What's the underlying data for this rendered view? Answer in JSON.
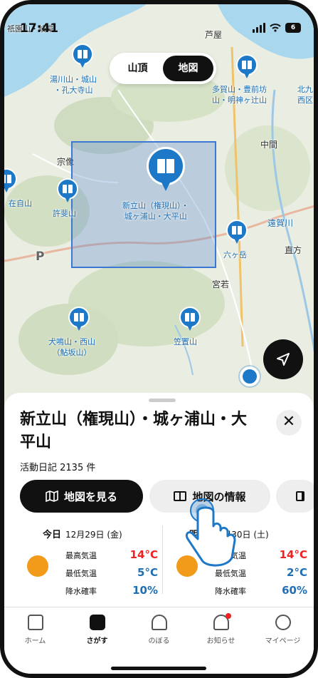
{
  "status": {
    "time": "17:41",
    "battery": "6"
  },
  "map_toggle": {
    "summit_label": "山頂",
    "map_label": "地図",
    "selected": "地図"
  },
  "map_labels": {
    "top_left_corner": "祇園山・岐阜",
    "ashiya": "芦屋",
    "yukawa": "湯川山・城山\n・孔大寺山",
    "tagasan": "多賀山・豊前坊\n山・明神ヶ辻山",
    "kitakyu": "北九\n西区",
    "nakama": "中間",
    "munakata": "宗像",
    "zaijiyama": "在自山",
    "kyogusan": "許斐山",
    "tatsuyama": "新立山（権現山）・\n城ヶ浦山・大平山",
    "ongagawa": "遠賀川",
    "rokugatake": "六ヶ岳",
    "nogata": "直方",
    "miyawaka": "宮若",
    "inunaki": "犬鳴山・西山\n（鮎坂山）",
    "kasaoki": "笠置山",
    "parking": "P"
  },
  "sheet": {
    "title": "新立山（権現山）・城ヶ浦山・大平山",
    "activity_count": "活動日記 2135 件",
    "view_map_button": "地図を見る",
    "map_info_button": "地図の情報"
  },
  "weather": [
    {
      "label": "今日",
      "date": "12月29日 (金)",
      "max_label": "最高気温",
      "max": "14°C",
      "min_label": "最低気温",
      "min": "5°C",
      "rain_label": "降水確率",
      "rain": "10%"
    },
    {
      "label": "明日",
      "date": "12月30日 (土)",
      "max_label": "最高気温",
      "max": "14°C",
      "min_label": "最低気温",
      "min": "2°C",
      "rain_label": "降水確率",
      "rain": "60%"
    }
  ],
  "tabs": [
    {
      "label": "ホーム",
      "icon": "home-icon"
    },
    {
      "label": "さがす",
      "icon": "map-search-icon",
      "active": true
    },
    {
      "label": "のぼる",
      "icon": "mountain-icon"
    },
    {
      "label": "お知らせ",
      "icon": "bell-icon",
      "badge": true
    },
    {
      "label": "マイページ",
      "icon": "user-icon"
    }
  ],
  "colors": {
    "accent": "#1e78c8",
    "max_temp": "#e22222",
    "min_temp": "#1e6fb5",
    "selection": "#3a78d4"
  }
}
